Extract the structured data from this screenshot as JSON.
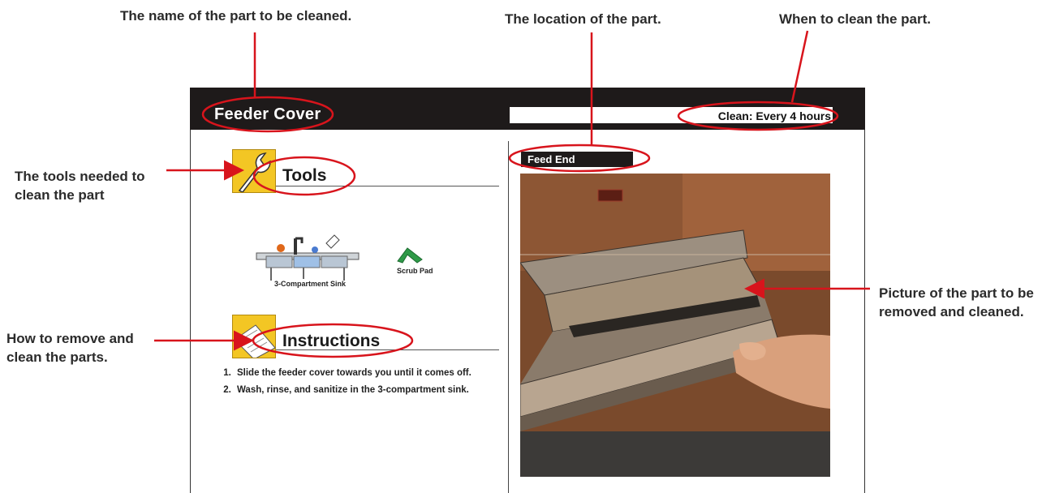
{
  "callouts": {
    "part_name": "The name of the part to be cleaned.",
    "location": "The location of the part.",
    "when": "When to clean the part.",
    "tools": "The tools needed to clean the part",
    "how": "How to remove and clean the parts.",
    "picture": "Picture of the part to be removed and cleaned."
  },
  "card": {
    "part_name": "Feeder Cover",
    "clean_when": "Clean: Every 4 hours",
    "location": "Feed End",
    "tools_heading": "Tools",
    "instructions_heading": "Instructions",
    "tools": [
      {
        "label": "3-Compartment Sink",
        "icon": "sink-icon"
      },
      {
        "label": "Scrub Pad",
        "icon": "scrub-pad-icon"
      }
    ],
    "steps": [
      "Slide the feeder cover towards you until it comes off.",
      "Wash, rinse, and sanitize in the 3-compartment sink."
    ]
  },
  "colors": {
    "title_bar": "#1e1a1a",
    "accent_red": "#d8141c",
    "icon_yellow": "#f3c624",
    "scrub_pad_green": "#2f9a48"
  }
}
